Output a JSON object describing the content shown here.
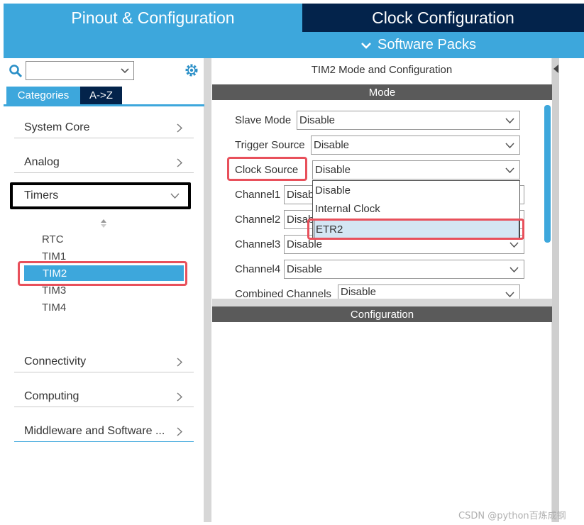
{
  "header": {
    "tab_left": "Pinout & Configuration",
    "tab_right": "Clock Configuration",
    "software_packs": "Software Packs"
  },
  "sidebar": {
    "search_placeholder": "",
    "tabs": [
      {
        "label": "Categories"
      },
      {
        "label": "A->Z"
      }
    ],
    "categories": [
      {
        "label": "System Core"
      },
      {
        "label": "Analog"
      },
      {
        "label": "Timers"
      },
      {
        "label": "Connectivity"
      },
      {
        "label": "Computing"
      },
      {
        "label": "Middleware and Software ..."
      }
    ],
    "timers": [
      "RTC",
      "TIM1",
      "TIM2",
      "TIM3",
      "TIM4"
    ],
    "selected_timer": "TIM2"
  },
  "main": {
    "title": "TIM2 Mode and Configuration",
    "mode_header": "Mode",
    "configuration_header": "Configuration",
    "fields": [
      {
        "label": "Slave Mode",
        "value": "Disable"
      },
      {
        "label": "Trigger Source",
        "value": "Disable"
      },
      {
        "label": "Clock Source",
        "value": "Disable"
      },
      {
        "label": "Channel1",
        "value": "Disable"
      },
      {
        "label": "Channel2",
        "value": "Disable"
      },
      {
        "label": "Channel3",
        "value": "Disable"
      },
      {
        "label": "Channel4",
        "value": "Disable"
      },
      {
        "label": "Combined Channels",
        "value": "Disable"
      }
    ],
    "clock_source_options": [
      "Disable",
      "Internal Clock",
      "ETR2"
    ],
    "clock_source_highlighted": "ETR2"
  },
  "watermark": "CSDN @python百炼成钢",
  "colors": {
    "accent": "#3da7dc",
    "dark_navy": "#03234b",
    "section_bar": "#5a5a5a",
    "highlight": "#e8505b",
    "selection_bg": "#d4e6f3"
  }
}
